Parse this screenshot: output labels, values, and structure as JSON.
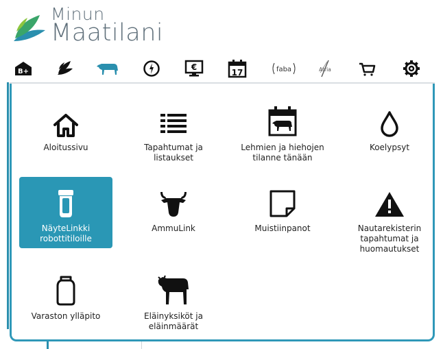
{
  "logo": {
    "line1": "Minun",
    "line2": "Maatilani"
  },
  "nav": [
    {
      "name": "b-plus-icon",
      "label": "B+"
    },
    {
      "name": "leaves-icon"
    },
    {
      "name": "cow-icon"
    },
    {
      "name": "compass-icon"
    },
    {
      "name": "euro-monitor-icon"
    },
    {
      "name": "calendar-icon",
      "label": "17"
    },
    {
      "name": "faba-logo-icon",
      "label": "faba"
    },
    {
      "name": "atria-logo-icon",
      "label": "Atria"
    },
    {
      "name": "cart-icon"
    },
    {
      "name": "gear-icon"
    }
  ],
  "tiles": [
    {
      "label": "Aloitussivu",
      "icon": "home-icon"
    },
    {
      "label": "Tapahtumat ja\nlistaukset",
      "icon": "list-icon"
    },
    {
      "label": "Lehmien ja hiehojen\ntilanne tänään",
      "icon": "calendar-cow-icon"
    },
    {
      "label": "Koelypsyt",
      "icon": "droplet-icon"
    },
    {
      "label": "NäyteLinkki\nrobottitiloille",
      "icon": "sample-vial-icon",
      "active": true
    },
    {
      "label": "AmmuLink",
      "icon": "cow-head-icon"
    },
    {
      "label": "Muistiinpanot",
      "icon": "note-icon"
    },
    {
      "label": "Nautarekisterin\ntapahtumat ja\nhuomautukset",
      "icon": "warning-icon"
    },
    {
      "label": "Varaston ylläpito",
      "icon": "milk-can-icon"
    },
    {
      "label": "Eläinyksiköt ja\neläinmäärät",
      "icon": "cow-silhouette-icon"
    }
  ],
  "colors": {
    "accent": "#2a97b5",
    "nav_active": "#2a8fae",
    "text": "#222222",
    "logo_text": "#5f6f7a",
    "leaf_green": "#3aa56a",
    "leaf_teal": "#2a8fae"
  }
}
